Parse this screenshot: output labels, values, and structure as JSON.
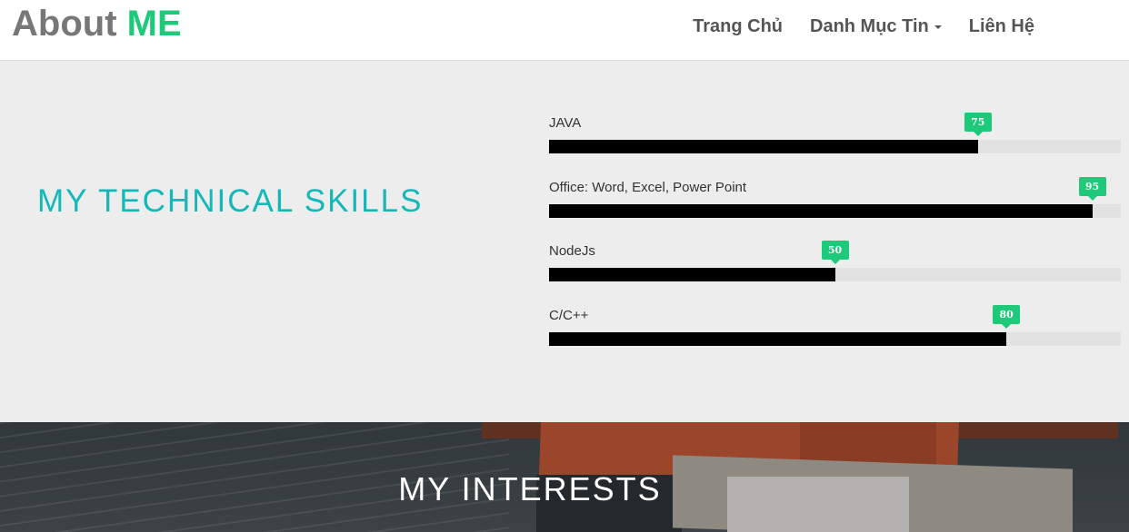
{
  "brand": {
    "text": "About",
    "accent": "ME"
  },
  "nav": {
    "home": "Trang Chủ",
    "categories": "Danh Mục Tin",
    "contact": "Liên Hệ"
  },
  "skills_section": {
    "title": "MY TECHNICAL SKILLS",
    "items": [
      {
        "label": "JAVA",
        "value": 75,
        "display": "75"
      },
      {
        "label": "Office: Word, Excel, Power Point",
        "value": 95,
        "display": "95"
      },
      {
        "label": "NodeJs",
        "value": 50,
        "display": "50"
      },
      {
        "label": "C/C++",
        "value": 80,
        "display": "80"
      }
    ]
  },
  "interests_section": {
    "title": "MY INTERESTS"
  },
  "colors": {
    "accent": "#1ec97a",
    "title": "#14b8b8",
    "bar": "#000000",
    "track": "#e2e2e2"
  }
}
